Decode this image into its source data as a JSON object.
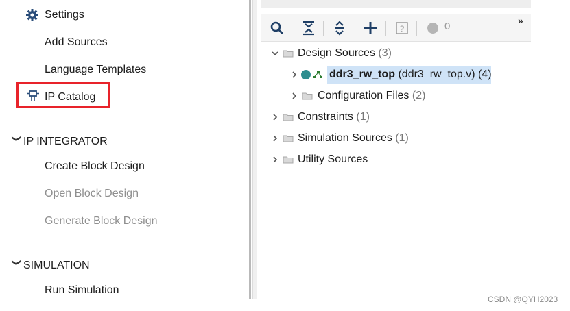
{
  "flow_navigator": {
    "project_manager_items": [
      {
        "label": "Settings"
      },
      {
        "label": "Add Sources"
      },
      {
        "label": "Language Templates"
      },
      {
        "label": "IP Catalog"
      }
    ],
    "sections": [
      {
        "title": "IP INTEGRATOR",
        "items": [
          {
            "label": "Create Block Design",
            "enabled": true
          },
          {
            "label": "Open Block Design",
            "enabled": false
          },
          {
            "label": "Generate Block Design",
            "enabled": false
          }
        ]
      },
      {
        "title": "SIMULATION",
        "items": [
          {
            "label": "Run Simulation",
            "enabled": true
          }
        ]
      }
    ],
    "highlight_color": "#e8232a"
  },
  "sources": {
    "toolbar": {
      "icons": [
        "search-icon",
        "collapse-all-icon",
        "expand-all-icon",
        "add-icon",
        "help-icon",
        "circle-icon"
      ],
      "count": "0",
      "more": "»"
    },
    "tree": {
      "design_sources": {
        "label": "Design Sources",
        "count": "(3)"
      },
      "top_module": {
        "name": "ddr3_rw_top",
        "file": "(ddr3_rw_top.v)",
        "count": "(4)"
      },
      "configuration_files": {
        "label": "Configuration Files",
        "count": "(2)"
      },
      "constraints": {
        "label": "Constraints",
        "count": "(1)"
      },
      "simulation_sources": {
        "label": "Simulation Sources",
        "count": "(1)"
      },
      "utility_sources": {
        "label": "Utility Sources"
      }
    },
    "selection_color": "#cfe3f7"
  },
  "watermark": "CSDN @QYH2023"
}
